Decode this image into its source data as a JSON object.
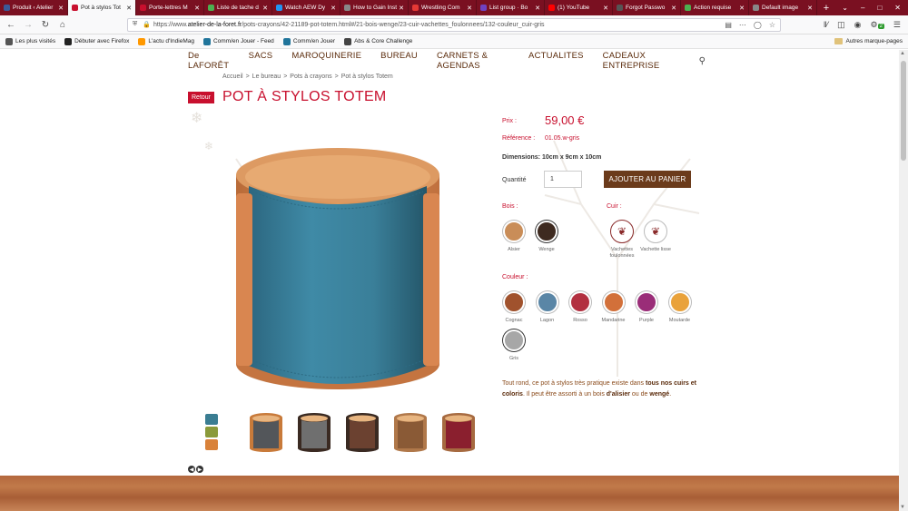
{
  "browser": {
    "tabs": [
      {
        "label": "Produit ‹ Atelier",
        "color": "#3b5998"
      },
      {
        "label": "Pot à stylos Tot",
        "color": "#c8102e",
        "active": true
      },
      {
        "label": "Porte-lettres M",
        "color": "#c8102e"
      },
      {
        "label": "Liste de tache d",
        "color": "#4caf50"
      },
      {
        "label": "Watch AEW Dy",
        "color": "#2196f3"
      },
      {
        "label": "How to Gain Insta",
        "color": "#888888"
      },
      {
        "label": "Wrestling Com",
        "color": "#e53935"
      },
      {
        "label": "List group · Bo",
        "color": "#6f42c1"
      },
      {
        "label": "(1) YouTube",
        "color": "#ff0000"
      },
      {
        "label": "Forgot Passwo",
        "color": "#555555"
      },
      {
        "label": "Action requise",
        "color": "#4caf50"
      },
      {
        "label": "Default image",
        "color": "#888888"
      }
    ],
    "url_prefix": "https://www.",
    "url_domain": "atelier-de-la-foret.fr",
    "url_path": "/pots-crayons/42-21189-pot-totem.html#/21-bois-wenge/23-cuir-vachettes_foulonnees/132-couleur_cuir-gris",
    "badge": "2",
    "bookmarks": [
      {
        "label": "Les plus visités",
        "color": "#555555"
      },
      {
        "label": "Débuter avec Firefox",
        "color": "#222222"
      },
      {
        "label": "L'actu d'IndieMag",
        "color": "#ff9800"
      },
      {
        "label": "Comm/en Jouer - Feed",
        "color": "#21759b"
      },
      {
        "label": "Comm/en Jouer",
        "color": "#21759b"
      },
      {
        "label": "Abs & Core Challenge",
        "color": "#444444"
      }
    ],
    "bookmarks_right": "Autres marque-pages"
  },
  "site": {
    "nav": [
      "De LAFORÊT",
      "SACS",
      "MAROQUINERIE",
      "BUREAU",
      "CARNETS & AGENDAS",
      "ACTUALITES",
      "CADEAUX ENTREPRISE"
    ],
    "breadcrumb": [
      "Accueil",
      "Le bureau",
      "Pots à crayons",
      "Pot à stylos Totem"
    ],
    "retour": "Retour",
    "title": "POT À STYLOS TOTEM"
  },
  "product": {
    "prix_label": "Prix :",
    "prix_value": "59,00 €",
    "ref_label": "Référence :",
    "ref_value": "01.05.w-gris",
    "dims_label": "Dimensions:",
    "dims_value": "10cm x 9cm x 10cm",
    "qty_label": "Quantité",
    "qty_value": "1",
    "add_button": "AJOUTER AU PANIER",
    "bois_label": "Bois :",
    "bois": [
      {
        "name": "Alsier",
        "color": "#c98d58"
      },
      {
        "name": "Wenge",
        "color": "#3e2a20",
        "selected": true
      }
    ],
    "cuir_label": "Cuir :",
    "cuir": [
      {
        "name": "Vachettes foulonnées",
        "selected": true
      },
      {
        "name": "Vachette lisse"
      }
    ],
    "couleur_label": "Couleur :",
    "couleurs": [
      {
        "name": "Cognac",
        "color": "#a0522d"
      },
      {
        "name": "Lagon",
        "color": "#5a86a6"
      },
      {
        "name": "Rosso",
        "color": "#b23040"
      },
      {
        "name": "Mandarine",
        "color": "#d2703a"
      },
      {
        "name": "Purple",
        "color": "#9a2d78"
      },
      {
        "name": "Moutarde",
        "color": "#e9a23b"
      },
      {
        "name": "Gris",
        "color": "#a7a7a7",
        "selected": true
      }
    ],
    "desc_parts": [
      "Tout rond, ce pot à stylos très pratique existe dans ",
      "tous nos cuirs et coloris",
      ". Il peut être assorti à un bois ",
      "d'alisier",
      " ou de ",
      "wengé",
      "."
    ],
    "thumbnails": [
      {
        "name": "stack",
        "leather": "#3a7d92",
        "wood": "#d9823a"
      },
      {
        "name": "grey-wenge",
        "leather": "#53565a",
        "wood": "#c87a3a"
      },
      {
        "name": "grey-dark",
        "leather": "#6f6f6f",
        "wood": "#3a2a22"
      },
      {
        "name": "brown-wenge",
        "leather": "#6b4130",
        "wood": "#3a2a22"
      },
      {
        "name": "cognac",
        "leather": "#8a5a36",
        "wood": "#b0784a"
      },
      {
        "name": "rosso",
        "leather": "#8a1f2e",
        "wood": "#a66a40"
      }
    ]
  },
  "colors": {
    "accent": "#c8102e",
    "brown": "#6b3b1b",
    "tab_bar": "#7a1021"
  }
}
